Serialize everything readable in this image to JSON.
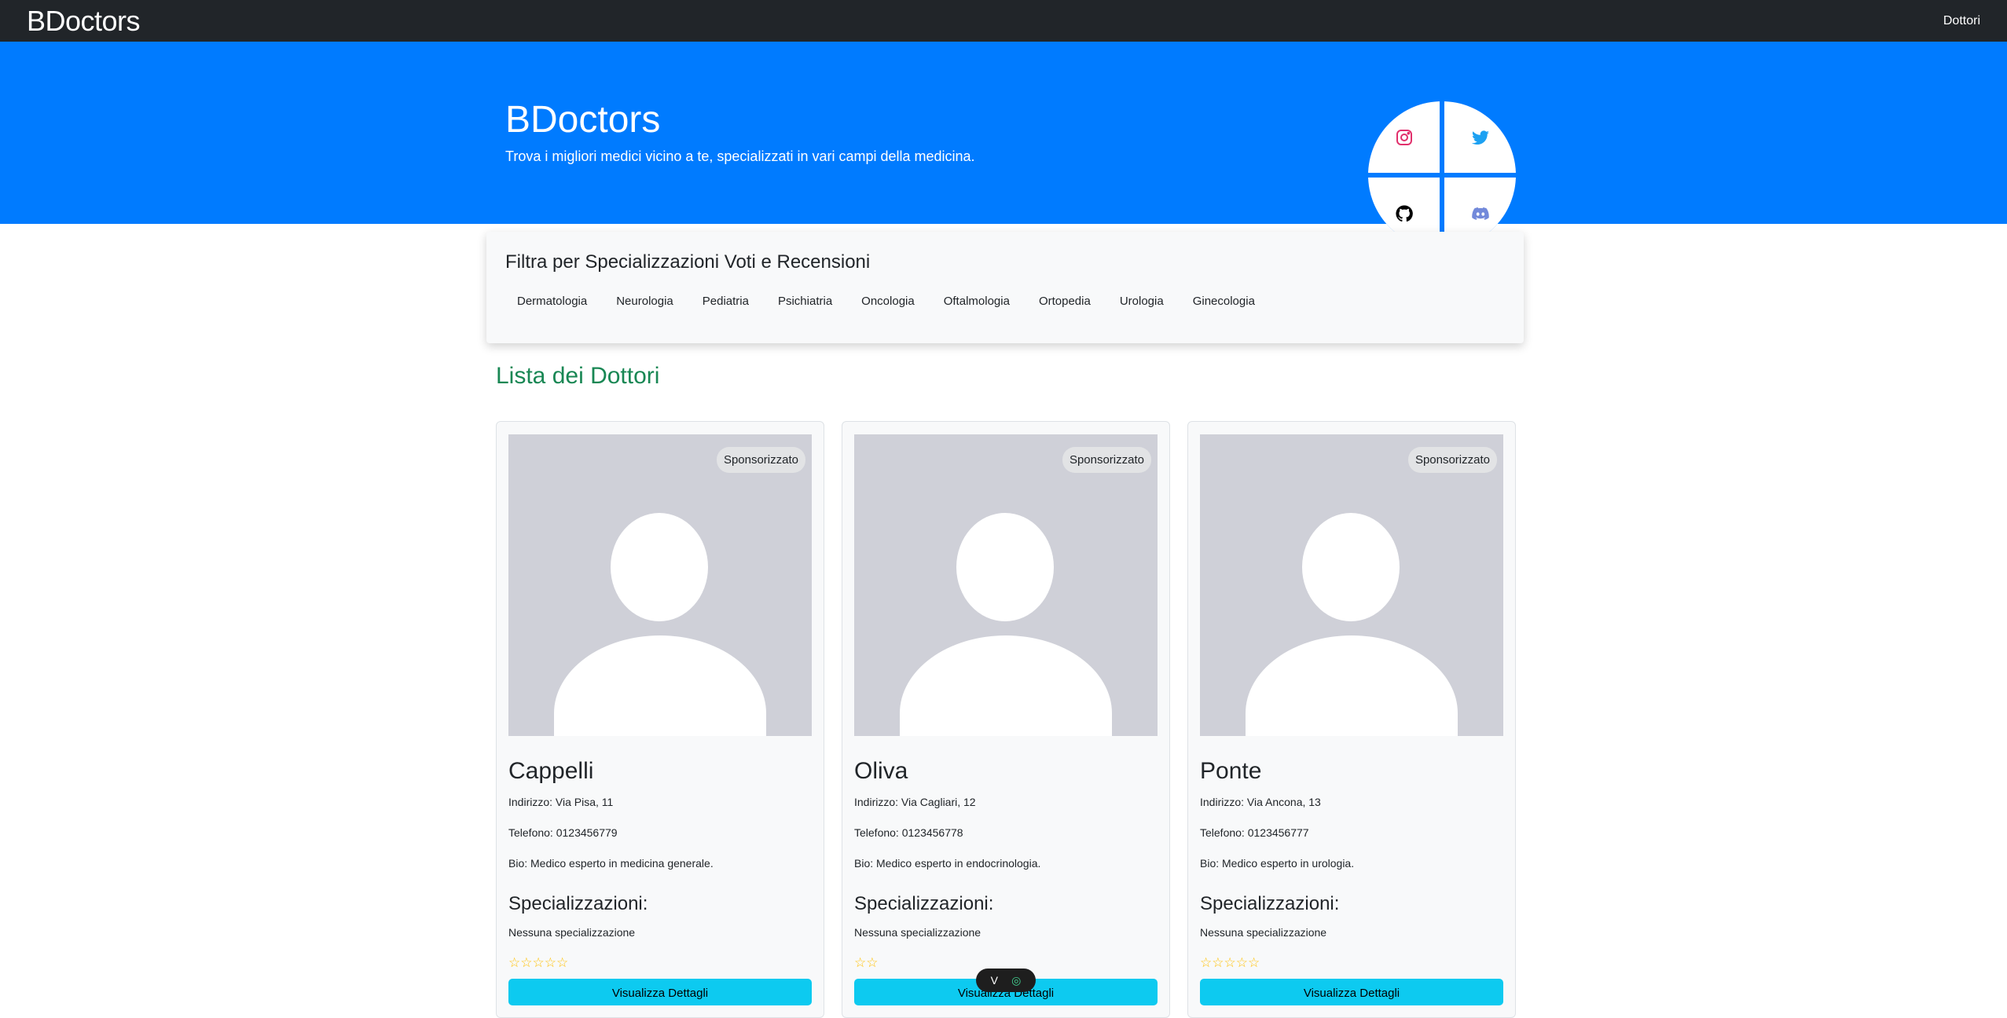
{
  "navbar": {
    "brand": "BDoctors",
    "link": "Dottori"
  },
  "hero": {
    "title": "BDoctors",
    "subtitle": "Trova i migliori medici vicino a te, specializzati in vari campi della medicina.",
    "social": [
      "instagram-icon",
      "twitter-icon",
      "github-icon",
      "discord-icon"
    ]
  },
  "filter": {
    "title": "Filtra per Specializzazioni Voti e Recensioni",
    "items": [
      "Dermatologia",
      "Neurologia",
      "Pediatria",
      "Psichiatria",
      "Oncologia",
      "Oftalmologia",
      "Ortopedia",
      "Urologia",
      "Ginecologia"
    ]
  },
  "list": {
    "title": "Lista dei Dottori"
  },
  "doctors": [
    {
      "badge": "Sponsorizzato",
      "name": "Cappelli",
      "address": "Indirizzo: Via Pisa, 11",
      "phone": "Telefono: 0123456779",
      "bio": "Bio: Medico esperto in medicina generale.",
      "spec_title": "Specializzazioni:",
      "spec_none": "Nessuna specializzazione",
      "stars": "☆☆☆☆☆",
      "rating": 0,
      "button": "Visualizza Dettagli"
    },
    {
      "badge": "Sponsorizzato",
      "name": "Oliva",
      "address": "Indirizzo: Via Cagliari, 12",
      "phone": "Telefono: 0123456778",
      "bio": "Bio: Medico esperto in endocrinologia.",
      "spec_title": "Specializzazioni:",
      "spec_none": "Nessuna specializzazione",
      "stars": "☆☆",
      "rating": 0,
      "button": "Visualizza Dettagli"
    },
    {
      "badge": "Sponsorizzato",
      "name": "Ponte",
      "address": "Indirizzo: Via Ancona, 13",
      "phone": "Telefono: 0123456777",
      "bio": "Bio: Medico esperto in urologia.",
      "spec_title": "Specializzazioni:",
      "spec_none": "Nessuna specializzazione",
      "stars": "☆☆☆☆☆",
      "rating": 0,
      "button": "Visualizza Dettagli"
    }
  ],
  "colors": {
    "navbar": "#212529",
    "hero": "#007bff",
    "heading_green": "#198754",
    "button": "#0dcaf0",
    "star": "#ffc107"
  }
}
